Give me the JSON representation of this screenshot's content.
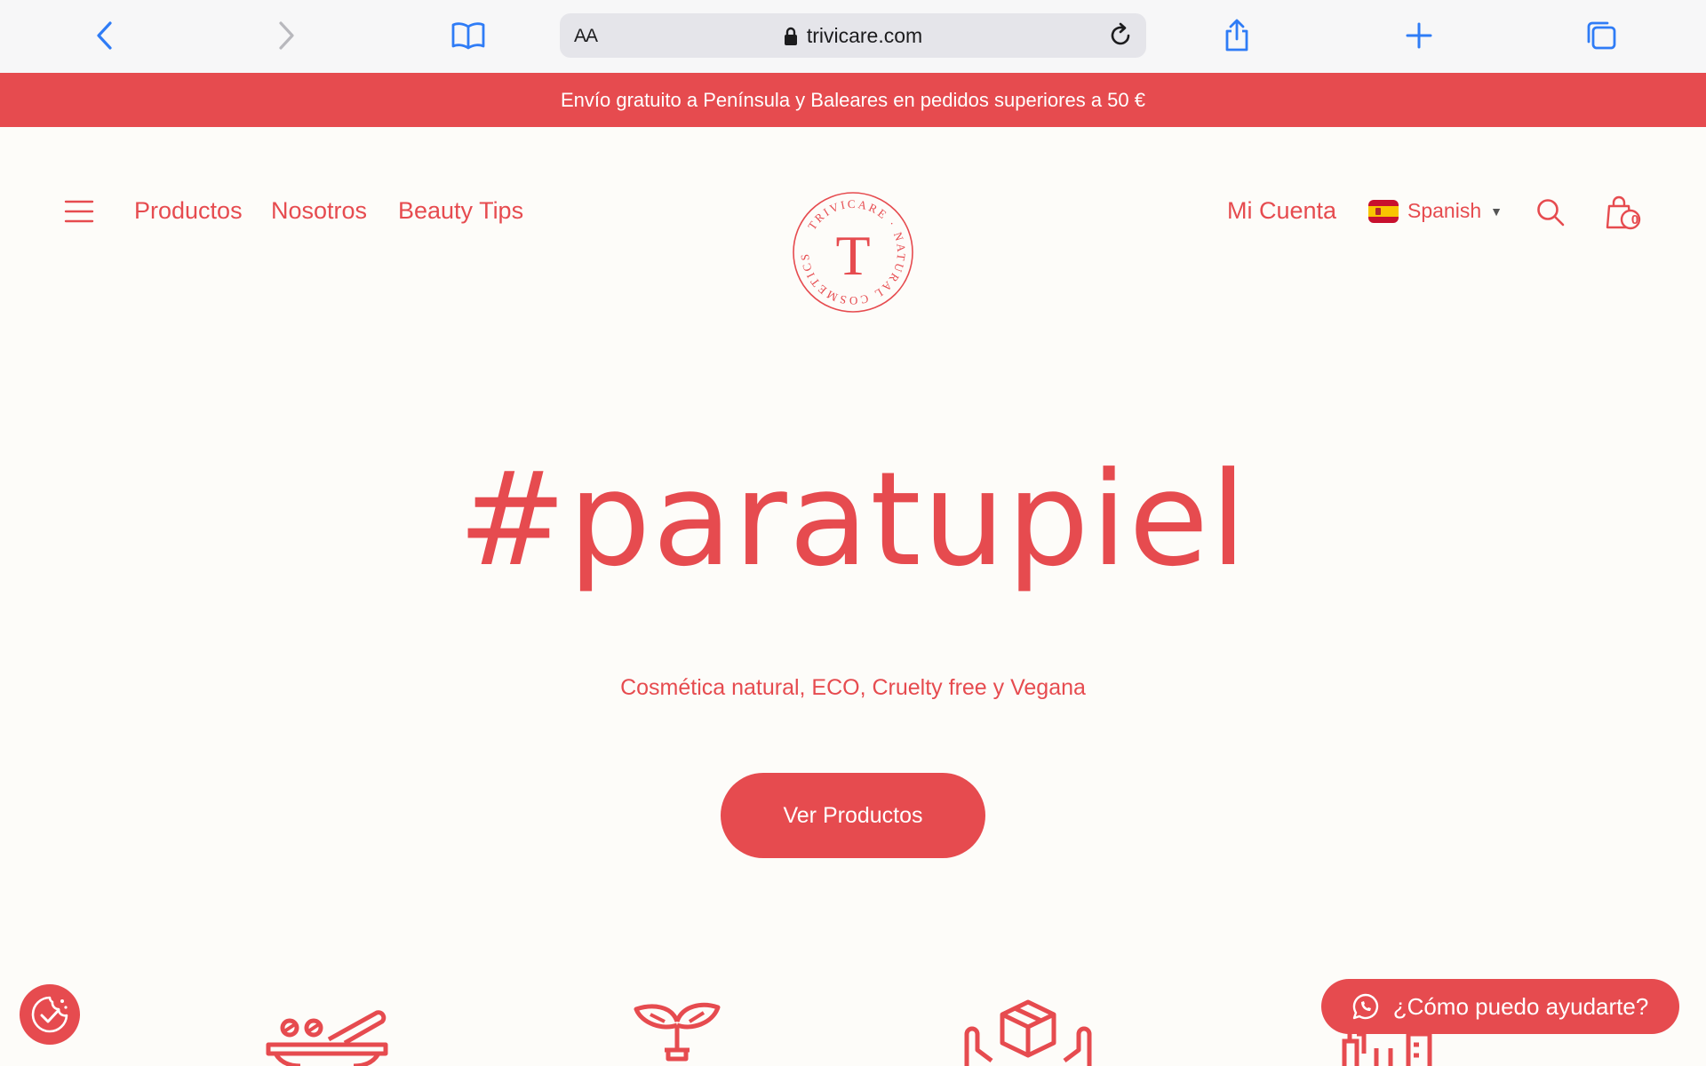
{
  "browser": {
    "address_prefix": "AA",
    "url": "trivicare.com"
  },
  "promo": {
    "text": "Envío gratuito a Península y Baleares en pedidos superiores a 50 €"
  },
  "nav": {
    "items": [
      "Productos",
      "Nosotros",
      "Beauty Tips"
    ],
    "account": "Mi Cuenta",
    "language": "Spanish",
    "cart_count": "0"
  },
  "logo": {
    "letter": "T",
    "ring_text": "TRIVICARE · NATURAL COSMETICS"
  },
  "hero": {
    "title": "#paratupiel",
    "subtitle": "Cosmética natural, ECO, Cruelty free y Vegana",
    "cta": "Ver Productos"
  },
  "chat": {
    "label": "¿Cómo puedo ayudarte?"
  },
  "icons": {
    "features": [
      "mortar-pestle-icon",
      "sprout-icon",
      "box-hands-icon",
      "bottles-icon"
    ]
  },
  "colors": {
    "accent": "#e64b4f",
    "background": "#fdfcf9",
    "ios_blue": "#2f7cf6"
  }
}
